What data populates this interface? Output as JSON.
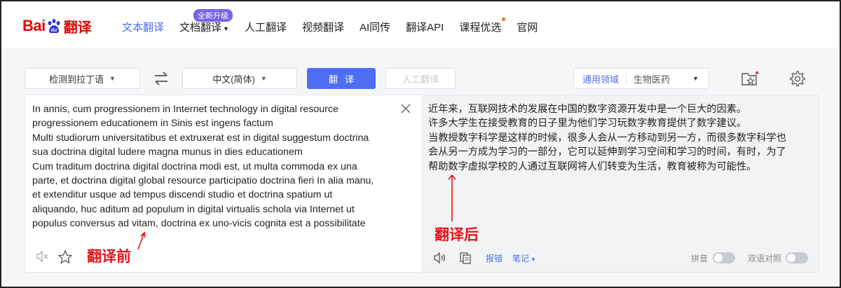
{
  "header": {
    "logo_text_bai": "Bai",
    "logo_text_du": "du",
    "logo_text_fanyi": "翻译",
    "nav": [
      {
        "label": "文本翻译",
        "active": true
      },
      {
        "label": "文档翻译",
        "badge": "全新升级",
        "has_caret": true
      },
      {
        "label": "人工翻译"
      },
      {
        "label": "视频翻译"
      },
      {
        "label": "AI同传"
      },
      {
        "label": "翻译API"
      },
      {
        "label": "课程优选",
        "has_dot": true
      },
      {
        "label": "官网"
      }
    ]
  },
  "toolbar": {
    "source_lang": "检测到拉丁语",
    "target_lang": "中文(简体)",
    "translate_label": "翻译",
    "human_translate_label": "人工翻译",
    "domain_selected": "通用领域",
    "domain_option": "生物医药"
  },
  "source": {
    "lines": [
      "In annis, cum progressionem in Internet technology in digital resource",
      "progressionem educationem in Sinis est ingens factum",
      "Multi studiorum universitatibus et extruxerat est in digital suggestum doctrina",
      "sua doctrina digital ludere magna munus in dies educationem",
      "Cum traditum doctrina digital doctrina modi est, ut multa commoda ex una",
      "parte, et doctrina digital global resource participatio doctrina fieri In alia manu,",
      "et extenditur usque ad tempus discendi studio et doctrina spatium ut",
      "aliquando, huc aditum ad populum in digital virtualis schola via Internet ut",
      "populus conversus ad vitam, doctrina ex uno-vicis cognita est a possibilitate"
    ]
  },
  "target": {
    "lines": [
      "近年来，互联网技术的发展在中国的数字资源开发中是一个巨大的因素。",
      "许多大学生在接受教育的日子里为他们学习玩数字教育提供了数字建议。",
      "当教授数字科学是这样的时候，很多人会从一方移动到另一方，而很多数字科学也",
      "会从另一方成为学习的一部分，它可以延伸到学习空间和学习的时间，有时，为了",
      "帮助数字虚拟学校的人通过互联网将人们转变为生活，教育被称为可能性。"
    ],
    "report_label": "报错",
    "notes_label": "笔记",
    "pinyin_label": "拼音",
    "bilingual_label": "双语对照"
  },
  "annotations": {
    "before": "翻译前",
    "after": "翻译后"
  },
  "colors": {
    "brand_red": "#e10601",
    "accent_blue": "#4e6ef2",
    "badge_purple": "#7a63e6",
    "annotation_red": "#e0161b"
  }
}
